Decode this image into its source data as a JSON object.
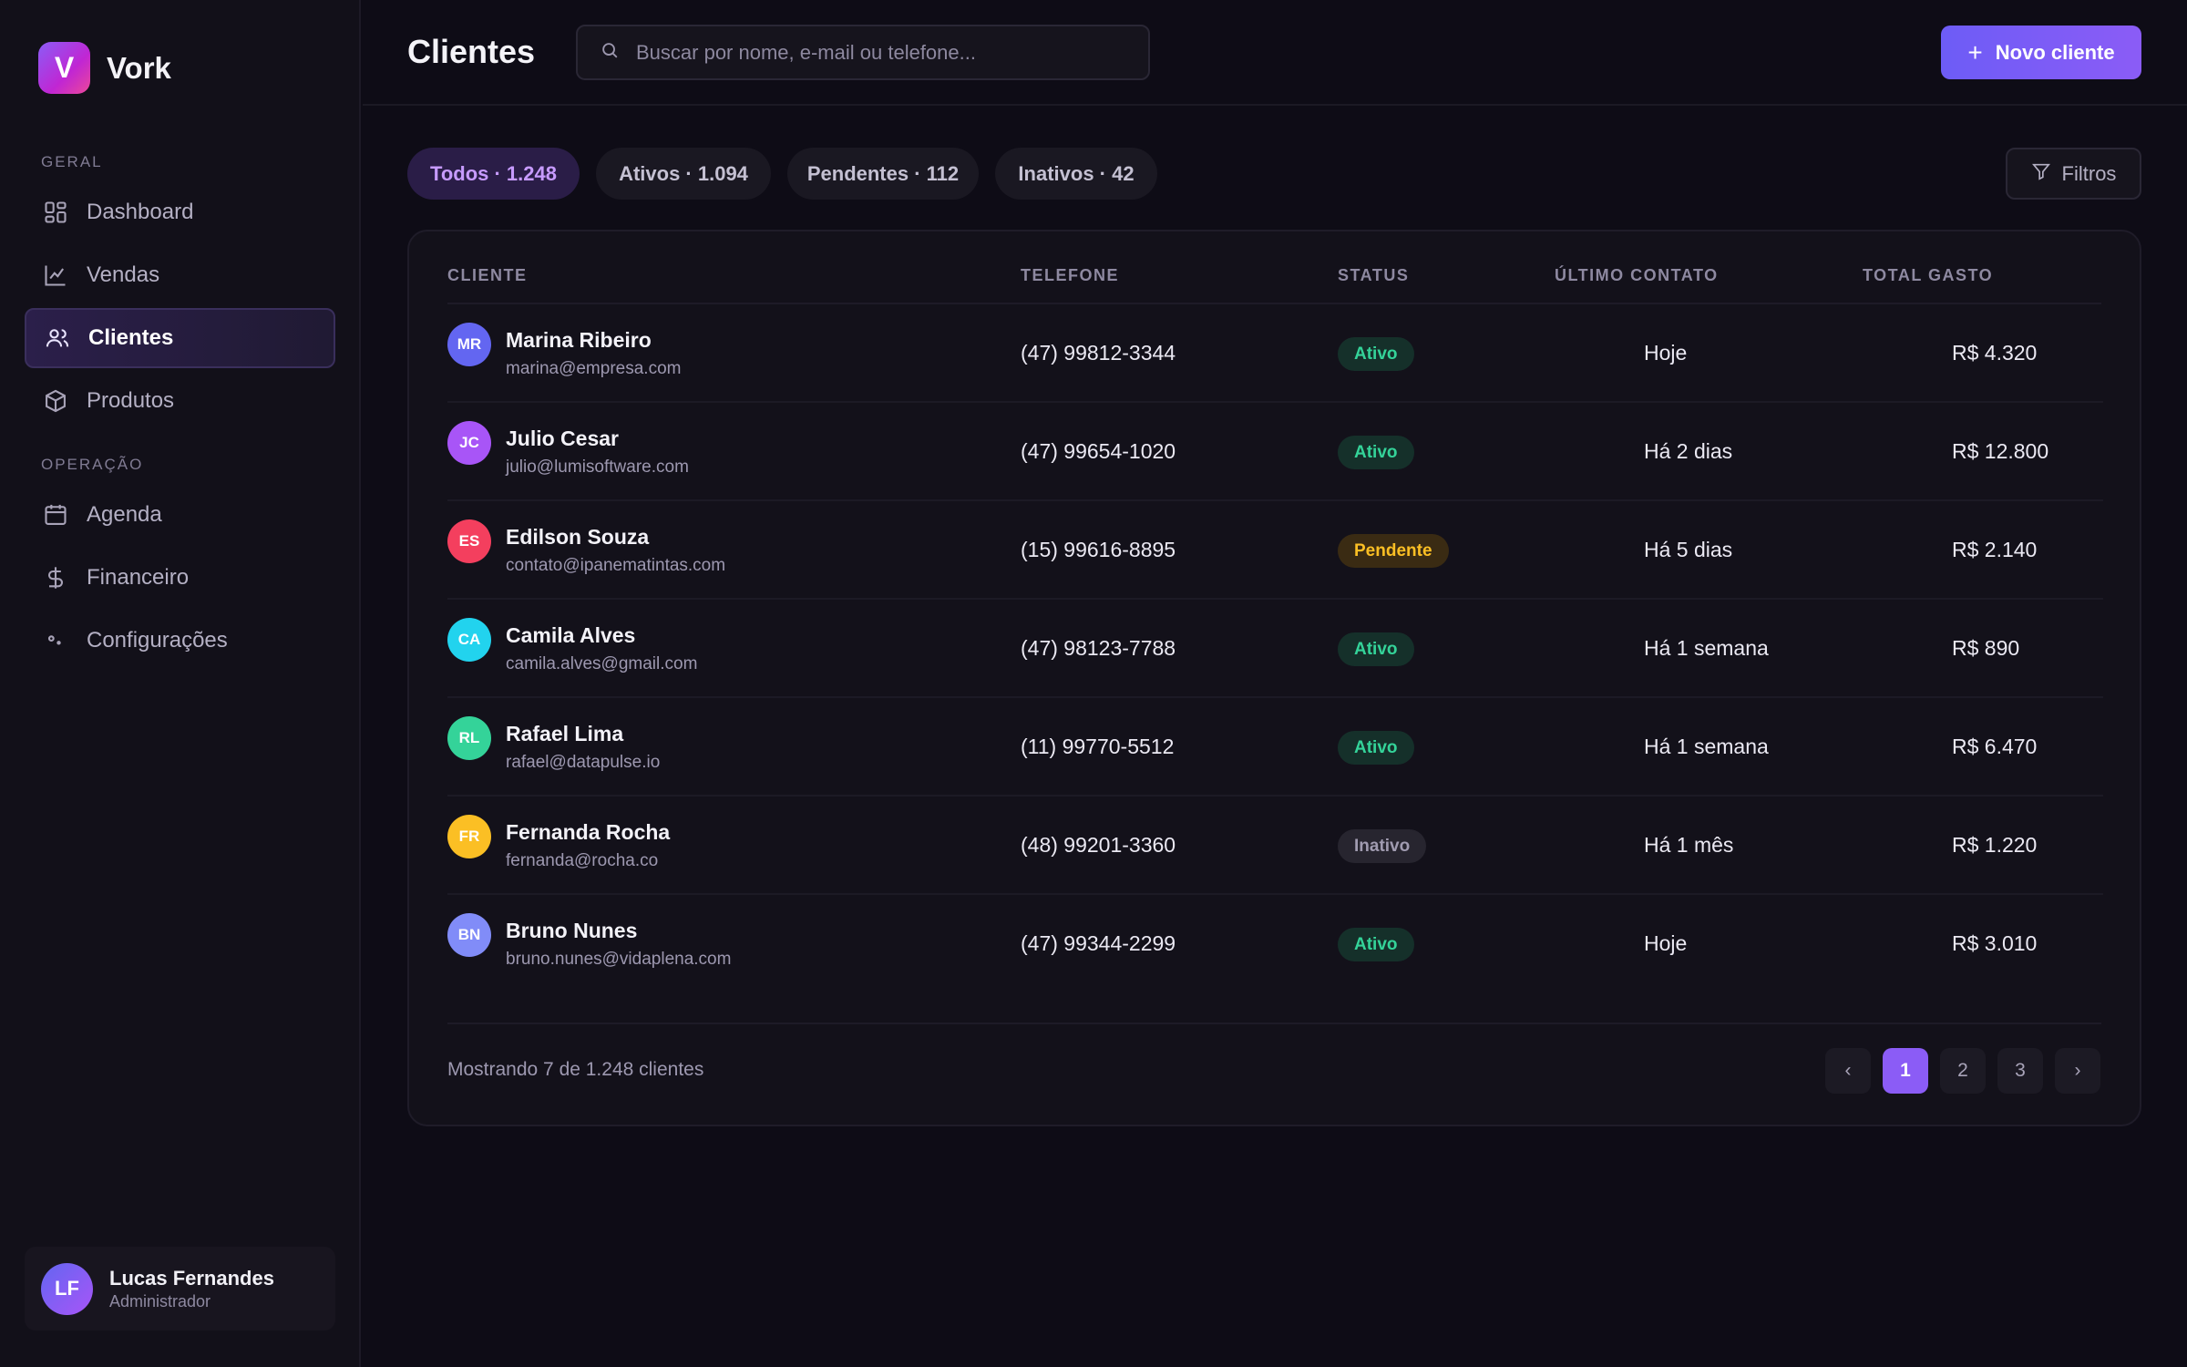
{
  "brand": {
    "logo_letter": "V",
    "name": "Vork"
  },
  "sidebar": {
    "sections": [
      "GERAL",
      "OPERAÇÃO"
    ],
    "items": [
      {
        "label": "Dashboard",
        "icon": "dashboard-grid-icon"
      },
      {
        "label": "Vendas",
        "icon": "line-chart-icon"
      },
      {
        "label": "Clientes",
        "icon": "users-icon",
        "active": true
      },
      {
        "label": "Produtos",
        "icon": "box-icon"
      },
      {
        "label": "Agenda",
        "icon": "calendar-icon"
      },
      {
        "label": "Financeiro",
        "icon": "dollar-icon"
      },
      {
        "label": "Configurações",
        "icon": "gear-icon"
      }
    ],
    "user": {
      "initials": "LF",
      "name": "Lucas Fernandes",
      "role": "Administrador"
    }
  },
  "header": {
    "title": "Clientes",
    "search_placeholder": "Buscar por nome, e-mail ou telefone...",
    "new_button": "Novo cliente"
  },
  "tabs": [
    {
      "label": "Todos · 1.248",
      "active": true
    },
    {
      "label": "Ativos · 1.094"
    },
    {
      "label": "Pendentes · 112"
    },
    {
      "label": "Inativos · 42"
    }
  ],
  "filters_button": "Filtros",
  "table": {
    "columns": [
      "CLIENTE",
      "TELEFONE",
      "STATUS",
      "ÚLTIMO CONTATO",
      "TOTAL GASTO"
    ],
    "rows": [
      {
        "initials": "MR",
        "avatar_color": "#6366f1",
        "name": "Marina Ribeiro",
        "email": "marina@empresa.com",
        "phone": "(47) 99812-3344",
        "status": "Ativo",
        "status_type": "ativo",
        "last_contact": "Hoje",
        "total": "R$ 4.320"
      },
      {
        "initials": "JC",
        "avatar_color": "#a855f7",
        "name": "Julio Cesar",
        "email": "julio@lumisoftware.com",
        "phone": "(47) 99654-1020",
        "status": "Ativo",
        "status_type": "ativo",
        "last_contact": "Há 2 dias",
        "total": "R$ 12.800"
      },
      {
        "initials": "ES",
        "avatar_color": "#f43f5e",
        "name": "Edilson Souza",
        "email": "contato@ipanematintas.com",
        "phone": "(15) 99616-8895",
        "status": "Pendente",
        "status_type": "pendente",
        "last_contact": "Há 5 dias",
        "total": "R$ 2.140"
      },
      {
        "initials": "CA",
        "avatar_color": "#22d3ee",
        "name": "Camila Alves",
        "email": "camila.alves@gmail.com",
        "phone": "(47) 98123-7788",
        "status": "Ativo",
        "status_type": "ativo",
        "last_contact": "Há 1 semana",
        "total": "R$ 890"
      },
      {
        "initials": "RL",
        "avatar_color": "#34d399",
        "name": "Rafael Lima",
        "email": "rafael@datapulse.io",
        "phone": "(11) 99770-5512",
        "status": "Ativo",
        "status_type": "ativo",
        "last_contact": "Há 1 semana",
        "total": "R$ 6.470"
      },
      {
        "initials": "FR",
        "avatar_color": "#fbbf24",
        "name": "Fernanda Rocha",
        "email": "fernanda@rocha.co",
        "phone": "(48) 99201-3360",
        "status": "Inativo",
        "status_type": "inativo",
        "last_contact": "Há 1 mês",
        "total": "R$ 1.220"
      },
      {
        "initials": "BN",
        "avatar_color": "#818cf8",
        "name": "Bruno Nunes",
        "email": "bruno.nunes@vidaplena.com",
        "phone": "(47) 99344-2299",
        "status": "Ativo",
        "status_type": "ativo",
        "last_contact": "Hoje",
        "total": "R$ 3.010"
      }
    ]
  },
  "footer": {
    "showing": "Mostrando 7 de 1.248 clientes",
    "pages": [
      "‹",
      "1",
      "2",
      "3",
      "›"
    ],
    "current_page": "1"
  }
}
